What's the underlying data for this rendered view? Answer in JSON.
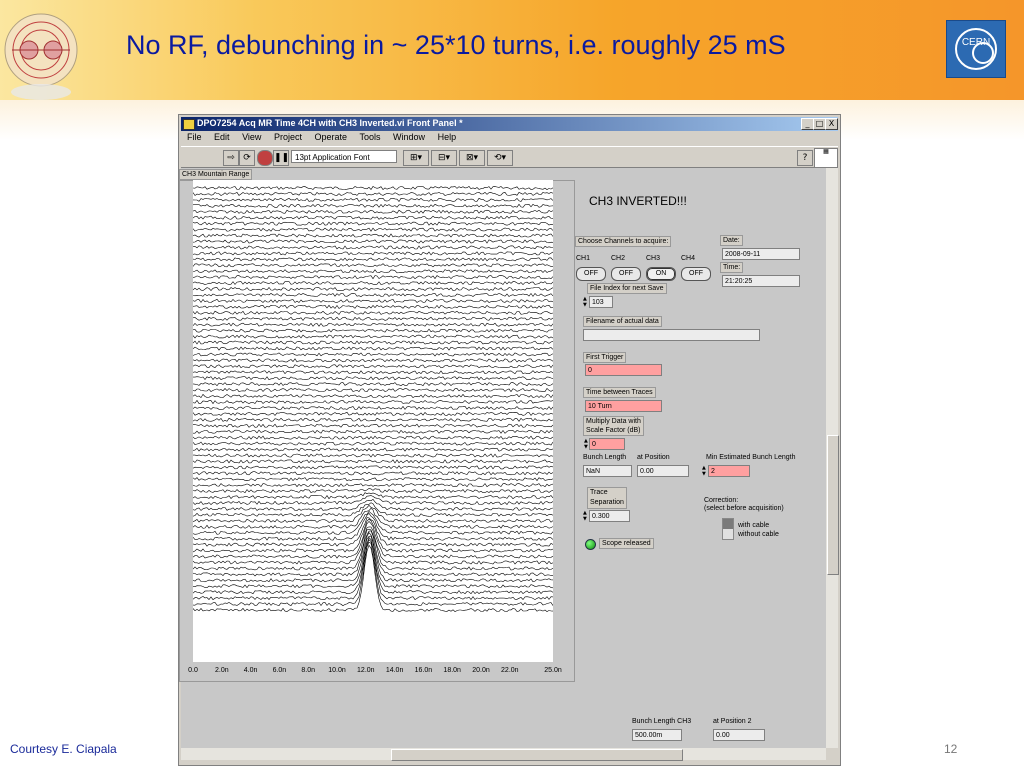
{
  "slide": {
    "title": "No RF,  debunching in ~ 25*10 turns,  i.e. roughly 25 mS",
    "credit": "Courtesy E. Ciapala",
    "page_number": "12",
    "cern_logo_text": "CERN"
  },
  "window": {
    "title": "DPO7254 Acq MR Time 4CH with CH3 Inverted.vi Front Panel *",
    "buttons": [
      "_",
      "□",
      "X"
    ],
    "menu": [
      "File",
      "Edit",
      "View",
      "Project",
      "Operate",
      "Tools",
      "Window",
      "Help"
    ],
    "font_selector": "13pt Application Font"
  },
  "graph": {
    "label": "CH3 Mountain Range",
    "x_ticks": [
      "0.0",
      "2.0n",
      "4.0n",
      "6.0n",
      "8.0n",
      "10.0n",
      "12.0n",
      "14.0n",
      "16.0n",
      "18.0n",
      "20.0n",
      "22.0n",
      "25.0n"
    ],
    "trace_count": 72,
    "line_color": "#000000"
  },
  "controls": {
    "banner": "CH3 INVERTED!!!",
    "choose_channels_label": "Choose Channels to acquire:",
    "channels": [
      {
        "name": "CH1",
        "state": "OFF"
      },
      {
        "name": "CH2",
        "state": "OFF"
      },
      {
        "name": "CH3",
        "state": "ON"
      },
      {
        "name": "CH4",
        "state": "OFF"
      }
    ],
    "date_label": "Date:",
    "date_value": "2008-09-11",
    "time_label": "Time:",
    "time_value": "21:20:25",
    "file_index_label": "File Index for next Save",
    "file_index_value": "103",
    "filename_label": "Filename of actual data",
    "filename_value": "",
    "first_trigger_label": "First Trigger",
    "first_trigger_value": "0",
    "time_between_label": "Time between Traces",
    "time_between_value": "10 Turn",
    "multiply_label_1": "Multiply Data with",
    "multiply_label_2": "Scale Factor (dB)",
    "multiply_value": "0",
    "bunch_length_label": "Bunch Length",
    "bunch_length_value": "NaN",
    "at_position_label": "at Position",
    "at_position_value": "0.00",
    "min_est_label": "Min Estimated Bunch Length",
    "min_est_value": "2",
    "trace_sep_label_1": "Trace",
    "trace_sep_label_2": "Separation",
    "trace_sep_value": "0.300",
    "correction_label_1": "Correction:",
    "correction_label_2": "(select before acquisition)",
    "with_cable": "with cable",
    "without_cable": "without cable",
    "scope_released": "Scope released",
    "bunch_length_ch3_label": "Bunch Length CH3",
    "bunch_length_ch3_value": "500.00m",
    "at_position2_label": "at Position 2",
    "at_position2_value": "0.00"
  }
}
